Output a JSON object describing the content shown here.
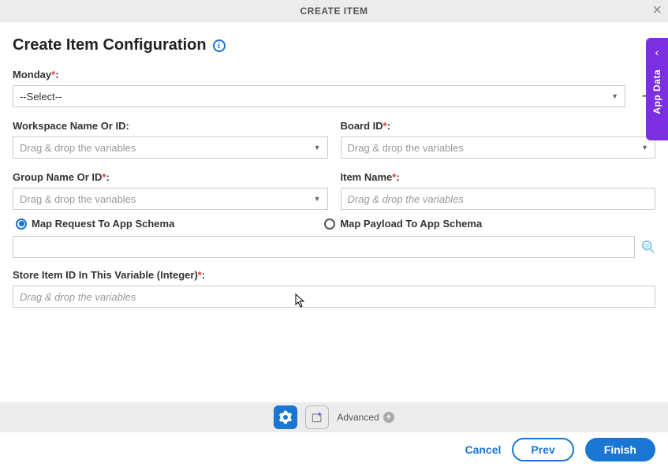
{
  "header": {
    "title": "CREATE ITEM"
  },
  "page": {
    "title": "Create Item Configuration"
  },
  "fields": {
    "monday": {
      "label": "Monday",
      "value": "--Select--"
    },
    "workspace": {
      "label": "Workspace Name Or ID:",
      "placeholder": "Drag & drop the variables"
    },
    "board": {
      "label": "Board ID",
      "placeholder": "Drag & drop the variables"
    },
    "group": {
      "label": "Group Name Or ID",
      "placeholder": "Drag & drop the variables"
    },
    "item": {
      "label": "Item Name",
      "placeholder": "Drag & drop the variables"
    },
    "store": {
      "label": "Store Item ID In This Variable (Integer)",
      "placeholder": "Drag & drop the variables"
    }
  },
  "radios": {
    "request": "Map Request To App Schema",
    "payload": "Map Payload To App Schema"
  },
  "toolbar": {
    "advanced": "Advanced"
  },
  "footer": {
    "cancel": "Cancel",
    "prev": "Prev",
    "finish": "Finish"
  },
  "sidetab": {
    "label": "App Data"
  }
}
